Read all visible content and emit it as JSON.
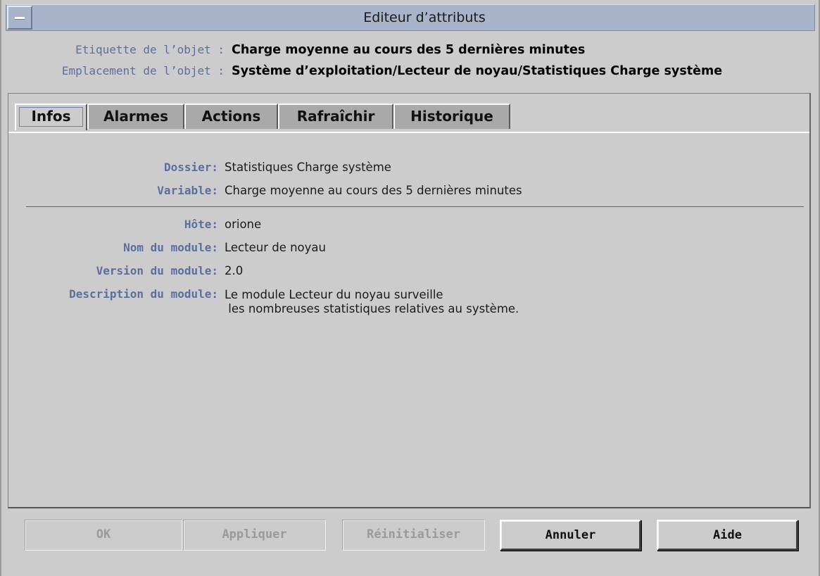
{
  "window": {
    "title": "Editeur d’attributs"
  },
  "header": {
    "label_row": {
      "label": "Etiquette de l’objet :",
      "value": "Charge moyenne au cours des 5 dernières minutes"
    },
    "location_row": {
      "label": "Emplacement de l’objet :",
      "value": "Système d’exploitation/Lecteur de noyau/Statistiques Charge système"
    }
  },
  "tabs": [
    {
      "label": "Infos",
      "active": true
    },
    {
      "label": "Alarmes",
      "active": false
    },
    {
      "label": "Actions",
      "active": false
    },
    {
      "label": "Rafraîchir",
      "active": false
    },
    {
      "label": "Historique",
      "active": false
    }
  ],
  "info": {
    "dossier": {
      "label": "Dossier:",
      "value": "Statistiques Charge système"
    },
    "variable": {
      "label": "Variable:",
      "value": "Charge moyenne au cours des 5 dernières minutes"
    },
    "hote": {
      "label": "Hôte:",
      "value": "orione"
    },
    "module_name": {
      "label": "Nom du module:",
      "value": "Lecteur de noyau"
    },
    "module_version": {
      "label": "Version du module:",
      "value": "2.0"
    },
    "module_description": {
      "label": "Description du module:",
      "value": "Le module Lecteur du noyau surveille\n les nombreuses statistiques relatives au système."
    }
  },
  "buttons": {
    "ok": {
      "label": "OK",
      "enabled": false
    },
    "apply": {
      "label": "Appliquer",
      "enabled": false
    },
    "reset": {
      "label": "Réinitialiser",
      "enabled": false
    },
    "cancel": {
      "label": "Annuler",
      "enabled": true
    },
    "help": {
      "label": "Aide",
      "enabled": true
    }
  },
  "colors": {
    "titlebar": "#a7b4c9",
    "background": "#cccccc",
    "label_blue": "#5a6fa0",
    "inactive_tab": "#a9a9a9"
  }
}
